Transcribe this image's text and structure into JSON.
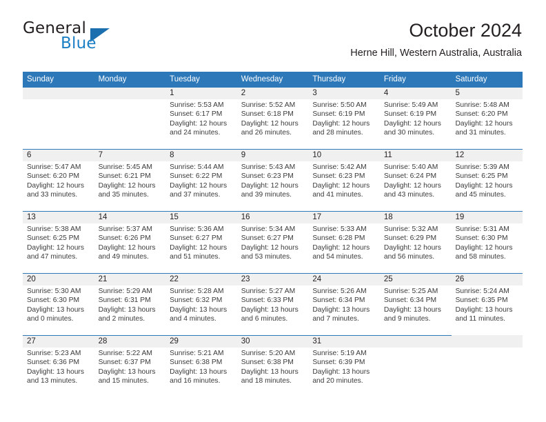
{
  "brand": {
    "name_part1": "General",
    "name_part2": "Blue",
    "logo_icon": "blue-triangle-logo"
  },
  "header": {
    "month_title": "October 2024",
    "location": "Herne Hill, Western Australia, Australia"
  },
  "colors": {
    "header_blue": "#2d78b9",
    "brand_blue": "#1b7fc4",
    "daynum_band": "#f0f0f0",
    "text": "#231f20"
  },
  "weekdays": [
    "Sunday",
    "Monday",
    "Tuesday",
    "Wednesday",
    "Thursday",
    "Friday",
    "Saturday"
  ],
  "weeks": [
    {
      "rule_width_pct": 100,
      "days": [
        {
          "num": "",
          "empty": true,
          "sunrise": "",
          "sunset": "",
          "daylight1": "",
          "daylight2": ""
        },
        {
          "num": "",
          "empty": true,
          "sunrise": "",
          "sunset": "",
          "daylight1": "",
          "daylight2": ""
        },
        {
          "num": "1",
          "empty": false,
          "sunrise": "Sunrise: 5:53 AM",
          "sunset": "Sunset: 6:17 PM",
          "daylight1": "Daylight: 12 hours",
          "daylight2": "and 24 minutes."
        },
        {
          "num": "2",
          "empty": false,
          "sunrise": "Sunrise: 5:52 AM",
          "sunset": "Sunset: 6:18 PM",
          "daylight1": "Daylight: 12 hours",
          "daylight2": "and 26 minutes."
        },
        {
          "num": "3",
          "empty": false,
          "sunrise": "Sunrise: 5:50 AM",
          "sunset": "Sunset: 6:19 PM",
          "daylight1": "Daylight: 12 hours",
          "daylight2": "and 28 minutes."
        },
        {
          "num": "4",
          "empty": false,
          "sunrise": "Sunrise: 5:49 AM",
          "sunset": "Sunset: 6:19 PM",
          "daylight1": "Daylight: 12 hours",
          "daylight2": "and 30 minutes."
        },
        {
          "num": "5",
          "empty": false,
          "sunrise": "Sunrise: 5:48 AM",
          "sunset": "Sunset: 6:20 PM",
          "daylight1": "Daylight: 12 hours",
          "daylight2": "and 31 minutes."
        }
      ]
    },
    {
      "rule_width_pct": 100,
      "days": [
        {
          "num": "6",
          "empty": false,
          "sunrise": "Sunrise: 5:47 AM",
          "sunset": "Sunset: 6:20 PM",
          "daylight1": "Daylight: 12 hours",
          "daylight2": "and 33 minutes."
        },
        {
          "num": "7",
          "empty": false,
          "sunrise": "Sunrise: 5:45 AM",
          "sunset": "Sunset: 6:21 PM",
          "daylight1": "Daylight: 12 hours",
          "daylight2": "and 35 minutes."
        },
        {
          "num": "8",
          "empty": false,
          "sunrise": "Sunrise: 5:44 AM",
          "sunset": "Sunset: 6:22 PM",
          "daylight1": "Daylight: 12 hours",
          "daylight2": "and 37 minutes."
        },
        {
          "num": "9",
          "empty": false,
          "sunrise": "Sunrise: 5:43 AM",
          "sunset": "Sunset: 6:23 PM",
          "daylight1": "Daylight: 12 hours",
          "daylight2": "and 39 minutes."
        },
        {
          "num": "10",
          "empty": false,
          "sunrise": "Sunrise: 5:42 AM",
          "sunset": "Sunset: 6:23 PM",
          "daylight1": "Daylight: 12 hours",
          "daylight2": "and 41 minutes."
        },
        {
          "num": "11",
          "empty": false,
          "sunrise": "Sunrise: 5:40 AM",
          "sunset": "Sunset: 6:24 PM",
          "daylight1": "Daylight: 12 hours",
          "daylight2": "and 43 minutes."
        },
        {
          "num": "12",
          "empty": false,
          "sunrise": "Sunrise: 5:39 AM",
          "sunset": "Sunset: 6:25 PM",
          "daylight1": "Daylight: 12 hours",
          "daylight2": "and 45 minutes."
        }
      ]
    },
    {
      "rule_width_pct": 100,
      "days": [
        {
          "num": "13",
          "empty": false,
          "sunrise": "Sunrise: 5:38 AM",
          "sunset": "Sunset: 6:25 PM",
          "daylight1": "Daylight: 12 hours",
          "daylight2": "and 47 minutes."
        },
        {
          "num": "14",
          "empty": false,
          "sunrise": "Sunrise: 5:37 AM",
          "sunset": "Sunset: 6:26 PM",
          "daylight1": "Daylight: 12 hours",
          "daylight2": "and 49 minutes."
        },
        {
          "num": "15",
          "empty": false,
          "sunrise": "Sunrise: 5:36 AM",
          "sunset": "Sunset: 6:27 PM",
          "daylight1": "Daylight: 12 hours",
          "daylight2": "and 51 minutes."
        },
        {
          "num": "16",
          "empty": false,
          "sunrise": "Sunrise: 5:34 AM",
          "sunset": "Sunset: 6:27 PM",
          "daylight1": "Daylight: 12 hours",
          "daylight2": "and 53 minutes."
        },
        {
          "num": "17",
          "empty": false,
          "sunrise": "Sunrise: 5:33 AM",
          "sunset": "Sunset: 6:28 PM",
          "daylight1": "Daylight: 12 hours",
          "daylight2": "and 54 minutes."
        },
        {
          "num": "18",
          "empty": false,
          "sunrise": "Sunrise: 5:32 AM",
          "sunset": "Sunset: 6:29 PM",
          "daylight1": "Daylight: 12 hours",
          "daylight2": "and 56 minutes."
        },
        {
          "num": "19",
          "empty": false,
          "sunrise": "Sunrise: 5:31 AM",
          "sunset": "Sunset: 6:30 PM",
          "daylight1": "Daylight: 12 hours",
          "daylight2": "and 58 minutes."
        }
      ]
    },
    {
      "rule_width_pct": 100,
      "days": [
        {
          "num": "20",
          "empty": false,
          "sunrise": "Sunrise: 5:30 AM",
          "sunset": "Sunset: 6:30 PM",
          "daylight1": "Daylight: 13 hours",
          "daylight2": "and 0 minutes."
        },
        {
          "num": "21",
          "empty": false,
          "sunrise": "Sunrise: 5:29 AM",
          "sunset": "Sunset: 6:31 PM",
          "daylight1": "Daylight: 13 hours",
          "daylight2": "and 2 minutes."
        },
        {
          "num": "22",
          "empty": false,
          "sunrise": "Sunrise: 5:28 AM",
          "sunset": "Sunset: 6:32 PM",
          "daylight1": "Daylight: 13 hours",
          "daylight2": "and 4 minutes."
        },
        {
          "num": "23",
          "empty": false,
          "sunrise": "Sunrise: 5:27 AM",
          "sunset": "Sunset: 6:33 PM",
          "daylight1": "Daylight: 13 hours",
          "daylight2": "and 6 minutes."
        },
        {
          "num": "24",
          "empty": false,
          "sunrise": "Sunrise: 5:26 AM",
          "sunset": "Sunset: 6:34 PM",
          "daylight1": "Daylight: 13 hours",
          "daylight2": "and 7 minutes."
        },
        {
          "num": "25",
          "empty": false,
          "sunrise": "Sunrise: 5:25 AM",
          "sunset": "Sunset: 6:34 PM",
          "daylight1": "Daylight: 13 hours",
          "daylight2": "and 9 minutes."
        },
        {
          "num": "26",
          "empty": false,
          "sunrise": "Sunrise: 5:24 AM",
          "sunset": "Sunset: 6:35 PM",
          "daylight1": "Daylight: 13 hours",
          "daylight2": "and 11 minutes."
        }
      ]
    },
    {
      "rule_width_pct": 85.8,
      "days": [
        {
          "num": "27",
          "empty": false,
          "sunrise": "Sunrise: 5:23 AM",
          "sunset": "Sunset: 6:36 PM",
          "daylight1": "Daylight: 13 hours",
          "daylight2": "and 13 minutes."
        },
        {
          "num": "28",
          "empty": false,
          "sunrise": "Sunrise: 5:22 AM",
          "sunset": "Sunset: 6:37 PM",
          "daylight1": "Daylight: 13 hours",
          "daylight2": "and 15 minutes."
        },
        {
          "num": "29",
          "empty": false,
          "sunrise": "Sunrise: 5:21 AM",
          "sunset": "Sunset: 6:38 PM",
          "daylight1": "Daylight: 13 hours",
          "daylight2": "and 16 minutes."
        },
        {
          "num": "30",
          "empty": false,
          "sunrise": "Sunrise: 5:20 AM",
          "sunset": "Sunset: 6:38 PM",
          "daylight1": "Daylight: 13 hours",
          "daylight2": "and 18 minutes."
        },
        {
          "num": "31",
          "empty": false,
          "sunrise": "Sunrise: 5:19 AM",
          "sunset": "Sunset: 6:39 PM",
          "daylight1": "Daylight: 13 hours",
          "daylight2": "and 20 minutes."
        },
        {
          "num": "",
          "empty": true,
          "sunrise": "",
          "sunset": "",
          "daylight1": "",
          "daylight2": ""
        },
        {
          "num": "",
          "empty": true,
          "sunrise": "",
          "sunset": "",
          "daylight1": "",
          "daylight2": ""
        }
      ]
    }
  ]
}
